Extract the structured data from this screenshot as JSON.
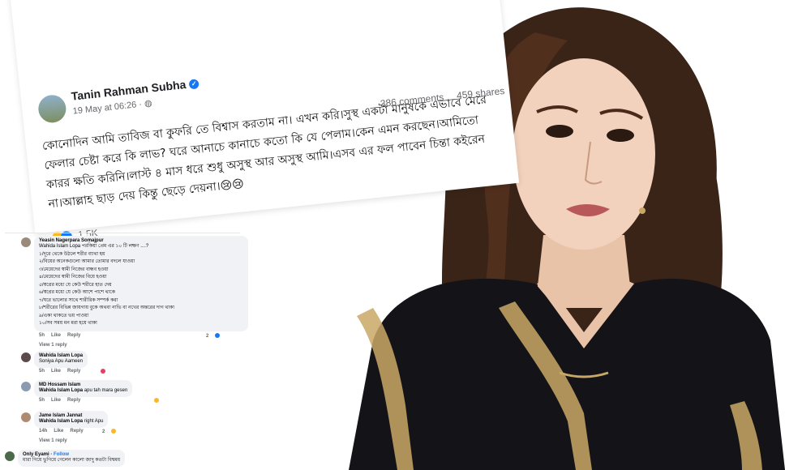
{
  "post": {
    "author": "Tanin Rahman Subha",
    "date": "19 May at 06:26 · ",
    "more_icon": "···",
    "body": "কোনোদিন আমি তাবিজ বা কুফরি তে বিশ্বাস করতাম না। এখন করি।সুস্থ একটা মানুষকে এভাবে মেরে ফেলার চেষ্টা করে কি লাভ? ঘরে আনাচে কানাচে কতো কি যে পেলাম।কেন এমন করছেন।আমিতো কারর ক্ষতি করিনি।লাস্ট ৪ মাস ধরে শুধু অসুস্থ আর অসুস্থ আমি।এসব এর ফল পাবেন চিন্তা কইরেন না।আল্লাহ ছাড় দেয় কিন্তু ছেড়ে দেয়না।😢😢",
    "comments_count": "386 comments",
    "shares_count": "459 shares",
    "reactions": "1.5K"
  },
  "comments": [
    {
      "name": "Yeasin Nagerpara Somajpur",
      "lines": [
        "Wahida Islam Lopa পরকিয়া প্রেম এর ১০ টি লক্ষণ ....?",
        "১/দূরে থেকে উঠলে শরীর ব্যাথা হয়",
        "২/বিয়ের অনেকগুলো আমার তোমার বদলে যাওয়া",
        "৩/মেয়েদের স্বামী নিজের বান্ধব হওয়া",
        "৪/মেয়েদের স্বামী নিজের বিয়ে হওয়া",
        "৫/স্বপ্নের মধ্যে যে কেউ শরীরে হাত দেয়",
        "৬/স্বপ্নের মধ্যে যে কেউ আশে পাশে থাকে",
        "৭/ঘরে ভালোর সাথে শারীরিক সম্পর্ক করা",
        "৮/শরীরের বিভিন্ন জায়গায় বুকে অথবা নাভি বা নখের অন্তরের দাগ থাকা",
        "৯/একা থাকতে ভয় পাওয়া",
        "১০/সব সময় মন মরা হয়ে থাকা"
      ],
      "time": "5h",
      "like": "Like",
      "reply": "Reply",
      "react_count": "2",
      "view_replies": "View 1 reply"
    },
    {
      "name": "Wahida Islam Lopa",
      "text": "Soniya Apu Aameen",
      "time": "5h",
      "like": "Like",
      "reply": "Reply"
    },
    {
      "name": "MD Hossam Islam",
      "mention": "Wahida Islam Lopa",
      "text": " apu tah mara gesen",
      "time": "5h",
      "like": "Like",
      "reply": "Reply"
    },
    {
      "name": "Jame Islam Jannat",
      "mention": "Wahida Islam Lopa",
      "text": " right Apu",
      "time": "14h",
      "like": "Like",
      "reply": "Reply",
      "react_count": "2",
      "view_replies": "View 1 reply"
    },
    {
      "name": "Only Eyami",
      "follow": "Follow",
      "text": "মারা গিয়ে ভুগিয়ে গেলেন কালো জাদু কতটা বিশ্বময়"
    }
  ],
  "colors": {
    "fb_blue": "#1877f2",
    "dress": "#141418",
    "embroidery": "#c9a866",
    "hair": "#3a2418"
  },
  "icons": [
    "verified-icon",
    "globe-icon",
    "more-icon",
    "like-reaction-icon",
    "sad-reaction-icon"
  ]
}
